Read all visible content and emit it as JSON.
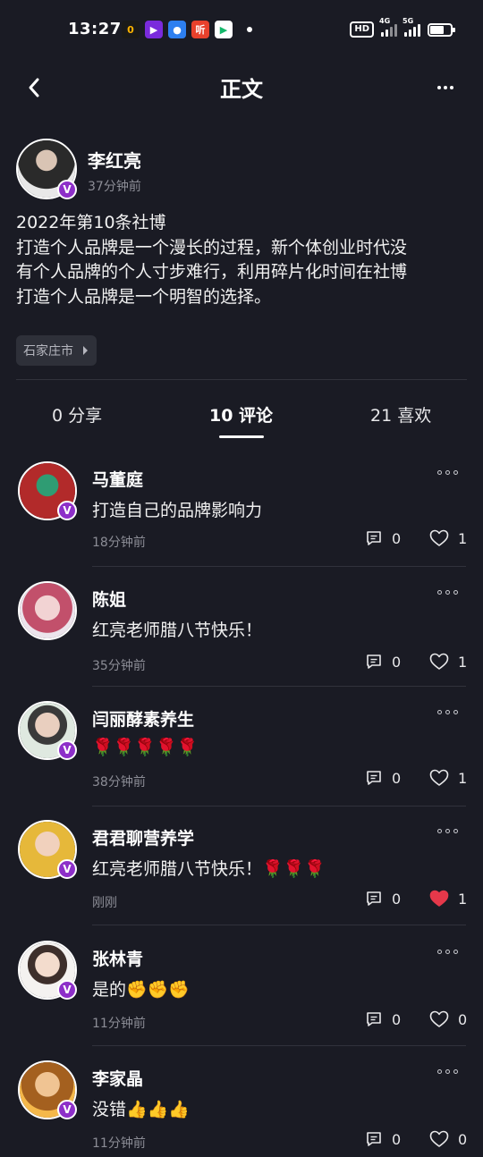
{
  "status_bar": {
    "time": "13:27",
    "apps": [
      {
        "name": "app-icon-1",
        "glyph": "0",
        "bg": "#1a1a1a",
        "fg": "#ffb400"
      },
      {
        "name": "app-icon-2",
        "glyph": "▶",
        "bg": "#7a2bdc",
        "fg": "#ffffff"
      },
      {
        "name": "app-icon-3",
        "glyph": "●",
        "bg": "#2d7ff0",
        "fg": "#ffffff"
      },
      {
        "name": "app-icon-4",
        "glyph": "听",
        "bg": "#e8412c",
        "fg": "#ffffff"
      },
      {
        "name": "app-icon-5",
        "glyph": "▶",
        "bg": "#ffffff",
        "fg": "#15b86b"
      }
    ],
    "hd": "HD",
    "net1": "4G",
    "net2": "5G"
  },
  "header": {
    "title": "正文"
  },
  "post": {
    "author": "李红亮",
    "time": "37分钟前",
    "lines": [
      "2022年第10条社博",
      "打造个人品牌是一个漫长的过程，新个体创业时代没",
      "有个人品牌的个人寸步难行，利用碎片化时间在社博",
      "打造个人品牌是一个明智的选择。"
    ],
    "location": "石家庄市"
  },
  "tabs": [
    {
      "label": "0 分享",
      "active": false
    },
    {
      "label": "10 评论",
      "active": true
    },
    {
      "label": "21 喜欢",
      "active": false
    }
  ],
  "comments": [
    {
      "name": "马董庭",
      "text": "打造自己的品牌影响力",
      "time": "18分钟前",
      "replies": "0",
      "likes": "1",
      "liked": false,
      "verified": true
    },
    {
      "name": "陈姐",
      "text": "红亮老师腊八节快乐！",
      "time": "35分钟前",
      "replies": "0",
      "likes": "1",
      "liked": false,
      "verified": false
    },
    {
      "name": "闫丽酵素养生",
      "text": "🌹🌹🌹🌹🌹",
      "time": "38分钟前",
      "replies": "0",
      "likes": "1",
      "liked": false,
      "verified": true
    },
    {
      "name": "君君聊营养学",
      "text": "红亮老师腊八节快乐！🌹🌹🌹",
      "time": "刚刚",
      "replies": "0",
      "likes": "1",
      "liked": true,
      "verified": true
    },
    {
      "name": "张林青",
      "text": "是的✊✊✊",
      "time": "11分钟前",
      "replies": "0",
      "likes": "0",
      "liked": false,
      "verified": true
    },
    {
      "name": "李家晶",
      "text": "没错👍👍👍",
      "time": "11分钟前",
      "replies": "0",
      "likes": "0",
      "liked": false,
      "verified": true
    }
  ],
  "colors": {
    "background": "#1a1b24",
    "accent_like": "#e5384a",
    "verified_badge": "#8d2fc9",
    "muted_text": "#8c8d96"
  },
  "icons": {
    "back": "chevron-left-icon",
    "more": "more-horizontal-icon",
    "reply": "comment-icon",
    "like": "heart-icon",
    "verified": "v-badge-icon"
  },
  "verified_letter": "V"
}
